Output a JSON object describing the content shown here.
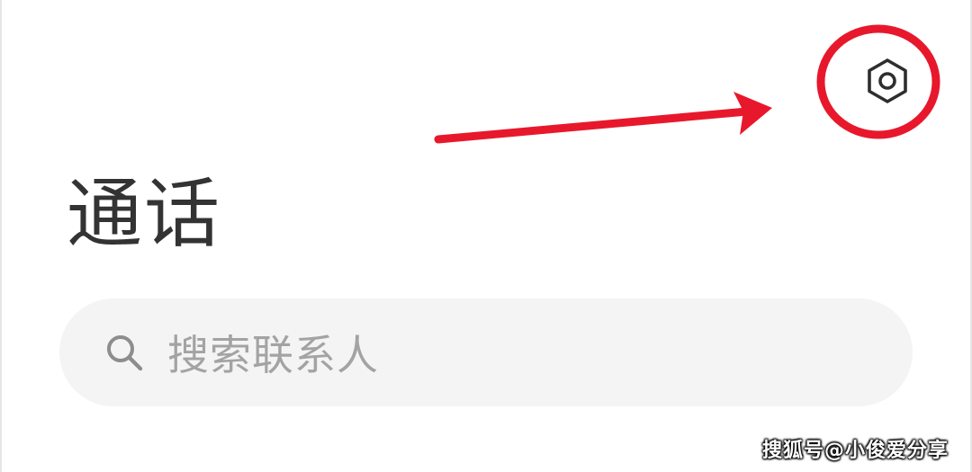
{
  "header": {
    "settings_icon": "hexagon-settings-icon"
  },
  "page": {
    "title": "通话"
  },
  "search": {
    "icon": "search-icon",
    "placeholder": "搜索联系人"
  },
  "annotation": {
    "color": "#e8182c",
    "arrow": "red-arrow-pointing-to-settings",
    "circle": "red-circle-highlight-around-settings"
  },
  "watermark": {
    "text": "搜狐号@小俊爱分享"
  }
}
